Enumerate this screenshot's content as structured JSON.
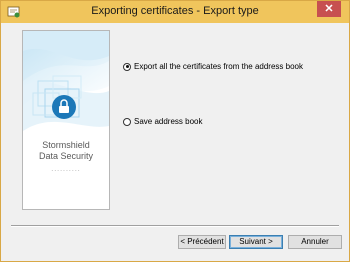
{
  "window": {
    "title": "Exporting certificates - Export type",
    "close_glyph": "✕",
    "titlebar_color": "#f0c55c"
  },
  "banner": {
    "brand_line1": "Stormshield",
    "brand_line2": "Data Security",
    "dots": "..........",
    "lock_color": "#1c78b8"
  },
  "options": {
    "export_all": {
      "label": "Export all the certificates from the address book",
      "selected": true
    },
    "save_book": {
      "label": "Save address book",
      "selected": false
    }
  },
  "buttons": {
    "previous": "< Précédent",
    "next": "Suivant >",
    "cancel": "Annuler"
  }
}
